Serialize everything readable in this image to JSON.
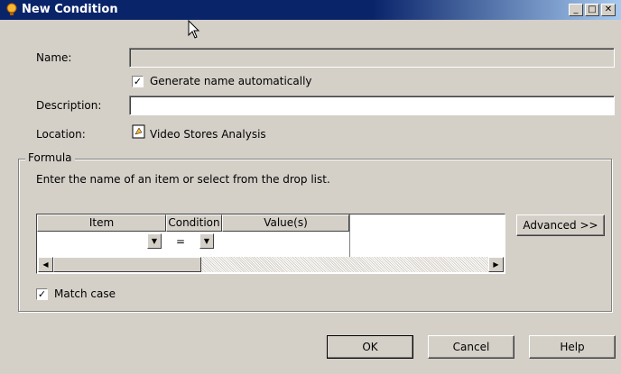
{
  "window": {
    "title": "New Condition"
  },
  "form": {
    "name_label": "Name:",
    "name_value": "",
    "generate_label": "Generate name automatically",
    "generate_checked": true,
    "description_label": "Description:",
    "description_value": "",
    "location_label": "Location:",
    "location_value": "Video Stores Analysis"
  },
  "formula": {
    "group_label": "Formula",
    "instructions": "Enter the name of an item or select from the drop list.",
    "columns": [
      "Item",
      "Condition",
      "Value(s)"
    ],
    "row": {
      "item": "",
      "condition": "=",
      "value": ""
    },
    "advanced_label": "Advanced >>",
    "match_case_label": "Match case",
    "match_case_checked": true
  },
  "buttons": {
    "ok": "OK",
    "cancel": "Cancel",
    "help": "Help"
  },
  "icons": [
    "location-icon",
    "lightbulb-icon",
    "cursor-icon"
  ]
}
